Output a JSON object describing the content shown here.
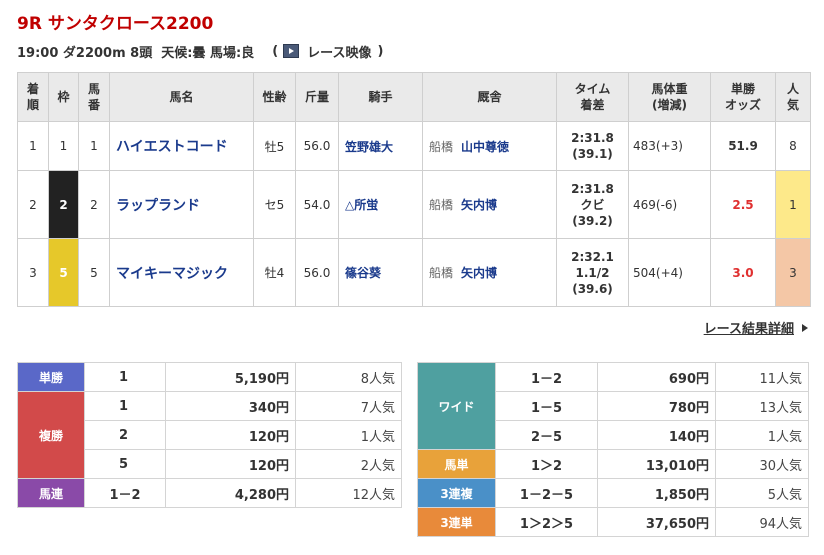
{
  "race": {
    "title": "9R サンタクロース2200",
    "info": "19:00 ダ2200m 8頭  天候:曇 馬場:良",
    "video_open": "(",
    "video_label": "レース映像",
    "video_close": ")"
  },
  "results": {
    "headers": [
      "着\n順",
      "枠",
      "馬\n番",
      "馬名",
      "性齢",
      "斤量",
      "騎手",
      "厩舎",
      "タイム\n着差",
      "馬体重\n(増減)",
      "単勝\nオッズ",
      "人\n気"
    ],
    "rows": [
      {
        "rank": "1",
        "waku": "1",
        "num": "1",
        "horse": "ハイエストコード",
        "sexage": "牡5",
        "weight": "56.0",
        "jockey": "笠野雄大",
        "loc": "船橋",
        "trainer": "山中尊徳",
        "time": "2:31.8",
        "margin": "",
        "gap": "(39.1)",
        "body": "483(+3)",
        "odds": "51.9",
        "pop": "8"
      },
      {
        "rank": "2",
        "waku": "2",
        "num": "2",
        "horse": "ラップランド",
        "sexage": "セ5",
        "weight": "54.0",
        "jockey": "△所蛍",
        "loc": "船橋",
        "trainer": "矢内博",
        "time": "2:31.8",
        "margin": "クビ",
        "gap": "(39.2)",
        "body": "469(-6)",
        "odds": "2.5",
        "pop": "1"
      },
      {
        "rank": "3",
        "waku": "5",
        "num": "5",
        "horse": "マイキーマジック",
        "sexage": "牡4",
        "weight": "56.0",
        "jockey": "篠谷葵",
        "loc": "船橋",
        "trainer": "矢内博",
        "time": "2:32.1",
        "margin": "1.1/2",
        "gap": "(39.6)",
        "body": "504(+4)",
        "odds": "3.0",
        "pop": "3"
      }
    ]
  },
  "detail_link": "レース結果詳細",
  "payout_left": {
    "tan": {
      "label": "単勝",
      "num": "1",
      "amount": "5,190円",
      "pop": "8人気"
    },
    "fuku": {
      "label": "複勝",
      "rows": [
        {
          "num": "1",
          "amount": "340円",
          "pop": "7人気"
        },
        {
          "num": "2",
          "amount": "120円",
          "pop": "1人気"
        },
        {
          "num": "5",
          "amount": "120円",
          "pop": "2人気"
        }
      ]
    },
    "umaren": {
      "label": "馬連",
      "num": "1－2",
      "amount": "4,280円",
      "pop": "12人気"
    }
  },
  "payout_right": {
    "wide": {
      "label": "ワイド",
      "rows": [
        {
          "num": "1－2",
          "amount": "690円",
          "pop": "11人気"
        },
        {
          "num": "1－5",
          "amount": "780円",
          "pop": "13人気"
        },
        {
          "num": "2－5",
          "amount": "140円",
          "pop": "1人気"
        }
      ]
    },
    "umatan": {
      "label": "馬単",
      "num": "1＞2",
      "amount": "13,010円",
      "pop": "30人気"
    },
    "sanpuku": {
      "label": "3連複",
      "num": "1－2－5",
      "amount": "1,850円",
      "pop": "5人気"
    },
    "santan": {
      "label": "3連単",
      "num": "1＞2＞5",
      "amount": "37,650円",
      "pop": "94人気"
    }
  },
  "colors": {
    "title_red": "#c00000",
    "link_blue": "#1a3a8c",
    "tan": "#5a68c8",
    "fuku": "#d24a4a",
    "umaren": "#8a4aa8",
    "wide": "#4fa0a0",
    "umatan": "#e8a23a",
    "sanpuku": "#4a90c8",
    "santan": "#e88a3a",
    "pop1_bg": "#fde98a",
    "pop2_bg": "#f4c7a6"
  }
}
